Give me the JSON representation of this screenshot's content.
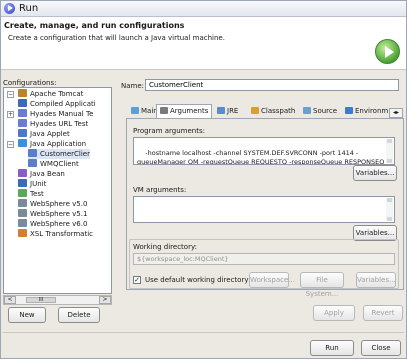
{
  "window": {
    "title": "Run"
  },
  "banner": {
    "title": "Create, manage, and run configurations",
    "subtitle": "Create a configuration that will launch a Java virtual machine.",
    "icon": "run-icon"
  },
  "configurations": {
    "label": "Configurations:",
    "items": [
      {
        "label": "Apache Tomcat",
        "icon": "tomcat-icon",
        "color": "#b8842e"
      },
      {
        "label": "Compiled Applicati",
        "icon": "compiled-app-icon",
        "color": "#3f67b8"
      },
      {
        "label": "Hyades Manual Te",
        "icon": "hyades-icon",
        "color": "#6b7bd4"
      },
      {
        "label": "Hyades URL Test",
        "icon": "hyades-icon",
        "color": "#6b7bd4"
      },
      {
        "label": "Java Applet",
        "icon": "applet-icon",
        "color": "#4c78c9"
      },
      {
        "label": "Java Application",
        "icon": "java-app-icon",
        "color": "#3f8fd8"
      },
      {
        "label": "CustomerClier",
        "icon": "java-class-icon",
        "color": "#5a7fc8"
      },
      {
        "label": "WMQClient",
        "icon": "java-class-icon",
        "color": "#5a7fc8"
      },
      {
        "label": "Java Bean",
        "icon": "bean-icon",
        "color": "#8a5cc4"
      },
      {
        "label": "JUnit",
        "icon": "junit-icon",
        "color": "#3a6ab8"
      },
      {
        "label": "Test",
        "icon": "test-icon",
        "color": "#5aa85a"
      },
      {
        "label": "WebSphere v5.0",
        "icon": "websphere-icon",
        "color": "#7a8a9a"
      },
      {
        "label": "WebSphere v5.1",
        "icon": "websphere-icon",
        "color": "#7a8a9a"
      },
      {
        "label": "WebSphere v6.0",
        "icon": "websphere-icon",
        "color": "#7a8a9a"
      },
      {
        "label": "XSL Transformatic",
        "icon": "xsl-icon",
        "color": "#d08030"
      }
    ],
    "scroll_left": "<",
    "scroll_mid": "III",
    "scroll_right": ">"
  },
  "buttons": {
    "new": "New",
    "delete": "Delete",
    "apply": "Apply",
    "revert": "Revert",
    "run": "Run",
    "close": "Close"
  },
  "name": {
    "label": "Name:",
    "value": "CustomerClient"
  },
  "tabs": [
    {
      "label": "Main",
      "icon": "main-tab-icon",
      "color": "#5aa0d8"
    },
    {
      "label": "Arguments",
      "icon": "arguments-tab-icon",
      "color": "#7a7a7a"
    },
    {
      "label": "JRE",
      "icon": "jre-tab-icon",
      "color": "#5a8ad0"
    },
    {
      "label": "Classpath",
      "icon": "classpath-tab-icon",
      "color": "#d8a030"
    },
    {
      "label": "Source",
      "icon": "source-tab-icon",
      "color": "#6aa0d0"
    },
    {
      "label": "Environm",
      "icon": "environment-tab-icon",
      "color": "#3a7ad8"
    }
  ],
  "program_args": {
    "label": "Program arguments:",
    "value": "-hostname localhost -channel SYSTEM.DEF.SVRCONN -port 1414 -queueManager QM -requestQueue REQUESTQ -responseQueue RESPONSEQ -transport client",
    "variables_button": "Variables..."
  },
  "vm_args": {
    "label": "VM arguments:",
    "value": "",
    "variables_button": "Variables..."
  },
  "working_dir": {
    "label": "Working directory:",
    "value": "${workspace_loc:MQClient}",
    "use_default_label": "Use default working directory",
    "use_default_checked": true,
    "workspace_button": "Workspace...",
    "filesystem_button": "File System...",
    "variables_button": "Variables..."
  }
}
